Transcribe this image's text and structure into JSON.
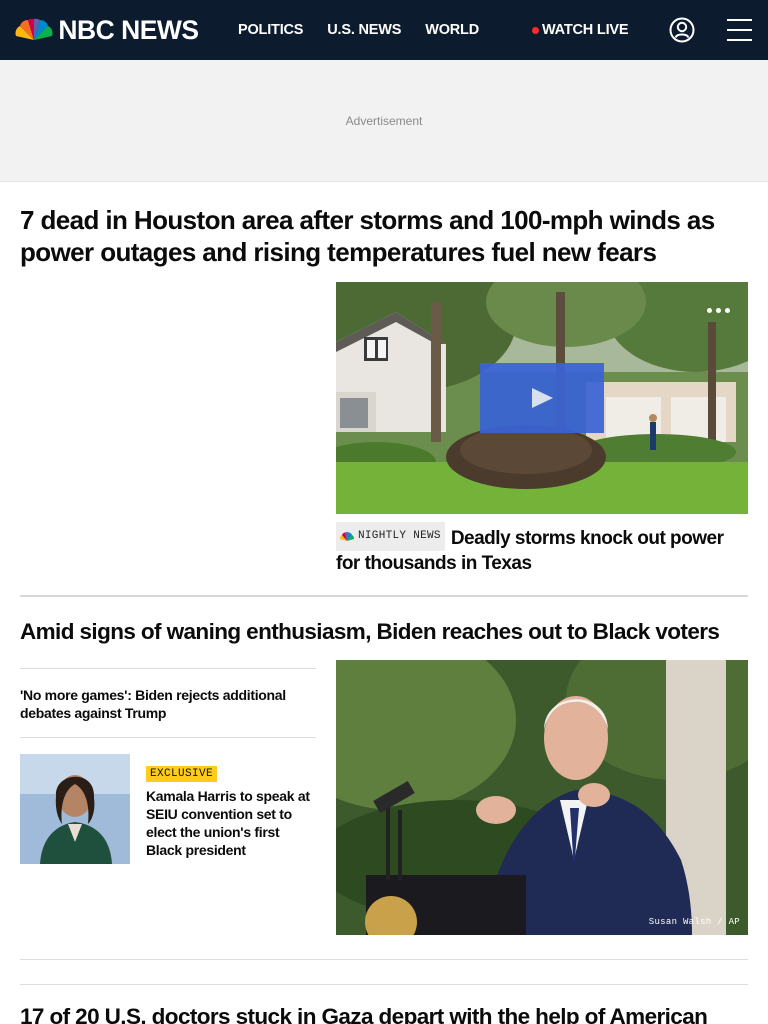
{
  "header": {
    "logo_text": "NBC NEWS",
    "nav": [
      "POLITICS",
      "U.S. NEWS",
      "WORLD"
    ],
    "watch_live": "WATCH LIVE",
    "colors": {
      "background": "#0c1b2e",
      "live_dot": "#ff2b2b"
    }
  },
  "ad": {
    "label": "Advertisement"
  },
  "lead": {
    "headline": "7 dead in Houston area after storms and 100-mph winds as power outages and rising temperatures fuel new fears",
    "video": {
      "show_label": "NIGHTLY NEWS",
      "caption": "Deadly storms knock out power for thousands in Texas",
      "more_icon": "more-horizontal-icon",
      "play_icon": "play-icon"
    }
  },
  "second": {
    "headline": "Amid signs of waning enthusiasm, Biden reaches out to Black voters",
    "related": [
      {
        "title": "'No more games': Biden rejects additional debates against Trump"
      },
      {
        "badge": "EXCLUSIVE",
        "title": "Kamala Harris to speak at SEIU convention set to elect the union's first Black president"
      }
    ],
    "photo_credit": "Susan Walsh / AP"
  },
  "third": {
    "headline": "17 of 20 U.S. doctors stuck in Gaza depart with the help of American"
  }
}
